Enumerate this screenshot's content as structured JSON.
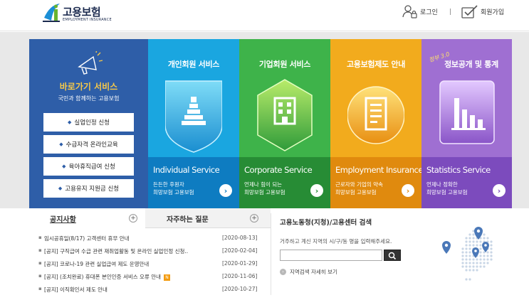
{
  "header": {
    "logo_title": "고용보험",
    "logo_sub": "EMPLOYMENT INSURANCE",
    "login_label": "로그인",
    "signup_label": "회원가입"
  },
  "shortcut": {
    "title": "바로가기 서비스",
    "subtitle": "국민과 함께하는 고용보험",
    "buttons": [
      "실업인정 신청",
      "수급자격 온라인교육",
      "육아휴직급여 신청",
      "고용유지 지원금 신청"
    ]
  },
  "services": [
    {
      "title": "개인회원 서비스",
      "en": "Individual Service",
      "desc1": "든든한 후원자",
      "desc2": "희망보험 고용보험"
    },
    {
      "title": "기업회원 서비스",
      "en": "Corporate Service",
      "desc1": "언제나 힘이 되는",
      "desc2": "희망보험 고용보험"
    },
    {
      "title": "고용보험제도 안내",
      "en": "Employment Insurance",
      "desc1": "근로자와 기업의 약속",
      "desc2": "희망보험 고용보험"
    },
    {
      "title": "정보공개 및 통계",
      "badge": "정부 3.0",
      "en": "Statistics Service",
      "desc1": "언제나 정확한",
      "desc2": "희망보험 고용보험"
    }
  ],
  "tabs": {
    "notice": "공지사항",
    "faq": "자주하는 질문"
  },
  "notices": [
    {
      "title": "임시공휴일(8/17) 고객센터 휴무 안내",
      "date": "[2020-08-13]",
      "is_new": false
    },
    {
      "title": "[공지] 구직급여 수급 관련 재취업활동 및 온라인 실업인정 신청..",
      "date": "[2020-02-04]",
      "is_new": false
    },
    {
      "title": "[공지] 코로나-19 관련 실업급여 제도 운영안내",
      "date": "[2020-01-29]",
      "is_new": false
    },
    {
      "title": "[공지] (조치완료) 휴대폰 본인인증 서비스 오류 안내",
      "date": "[2020-11-06]",
      "is_new": true,
      "new_label": "N"
    },
    {
      "title": "[공지] 이직확인서 제도 안내",
      "date": "[2020-10-27]",
      "is_new": false
    }
  ],
  "center": {
    "title": "고용노동청(지청)/고용센터 검색",
    "desc": "거주하고 계신 지역의 시/구/동 명을 입력해주세요.",
    "search_value": "",
    "link": "지역검색 자세히 보기"
  },
  "colors": {
    "shortcut": "#2e5ea8",
    "individual": "#1aa6e0",
    "corporate": "#3eb34a",
    "employment": "#f2ab1d",
    "statistics": "#9f6fd2"
  }
}
